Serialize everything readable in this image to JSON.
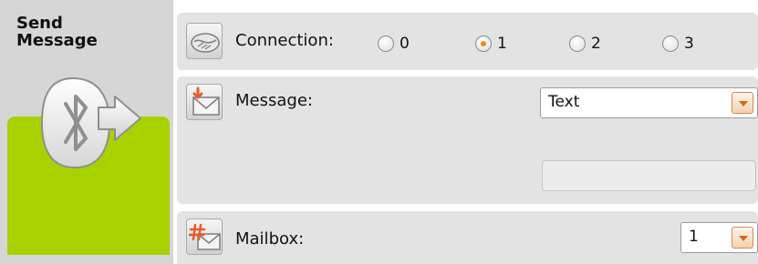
{
  "block": {
    "title_line1": "Send",
    "title_line2": "Message",
    "icon": "bluetooth-send-icon",
    "accent_color": "#a7d200"
  },
  "connection": {
    "label": "Connection:",
    "icon": "handshake-icon",
    "options": [
      "0",
      "1",
      "2",
      "3"
    ],
    "selected": "1"
  },
  "message": {
    "label": "Message:",
    "icon": "envelope-in-icon",
    "type_selected": "Text",
    "value": ""
  },
  "mailbox": {
    "label": "Mailbox:",
    "icon": "hash-envelope-icon",
    "selected": "1"
  },
  "colors": {
    "panel": "#e3e3e3",
    "radio_dot": "#f08a1c",
    "dropdown_button": "#f6d1ad"
  }
}
